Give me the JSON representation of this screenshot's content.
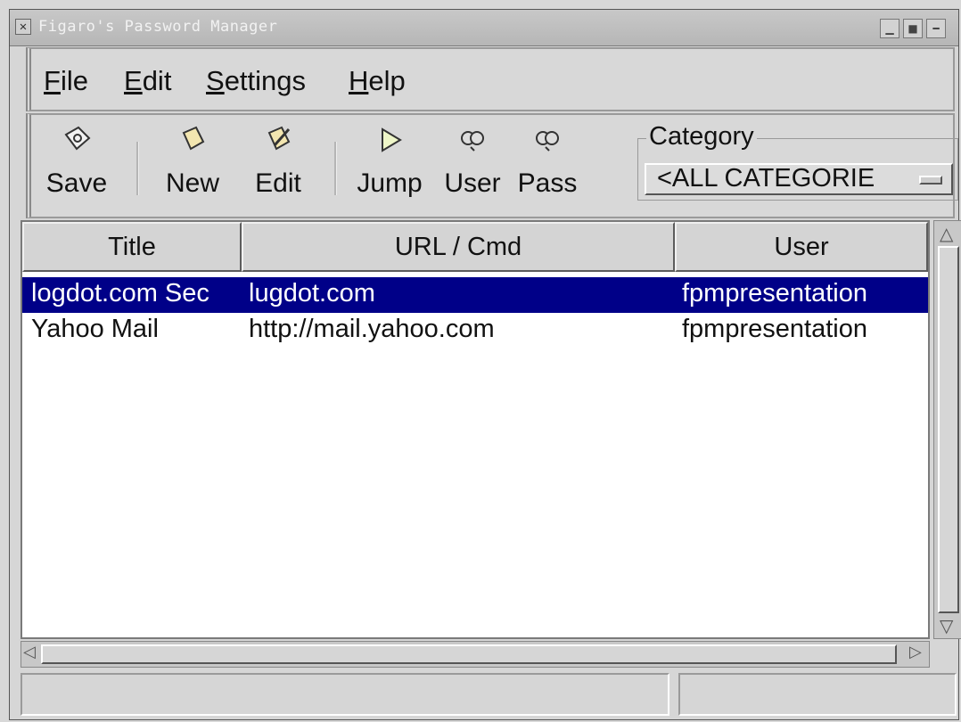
{
  "window": {
    "title": "Figaro's Password Manager",
    "close_glyph": "✕",
    "minimize_glyph": "▁",
    "maximize_glyph": "■",
    "shade_glyph": "━"
  },
  "menu": {
    "file": {
      "first": "F",
      "rest": "ile"
    },
    "edit": {
      "first": "E",
      "rest": "dit"
    },
    "settings": {
      "first": "S",
      "rest": "ettings"
    },
    "help": {
      "first": "H",
      "rest": "elp"
    }
  },
  "toolbar": {
    "save": "Save",
    "new": "New",
    "edit": "Edit",
    "jump": "Jump",
    "user": "User",
    "pass": "Pass",
    "category_label": "Category",
    "category_value": "<ALL CATEGORIE"
  },
  "table": {
    "columns": [
      "Title",
      "URL / Cmd",
      "User"
    ],
    "rows": [
      {
        "title": "logdot.com Sec",
        "url": "lugdot.com",
        "user": "fpmpresentation",
        "selected": true
      },
      {
        "title": "Yahoo Mail",
        "url": "http://mail.yahoo.com",
        "user": "fpmpresentation",
        "selected": false
      }
    ]
  },
  "colors": {
    "selection": "#000088",
    "window_bg": "#d6d6d6"
  }
}
